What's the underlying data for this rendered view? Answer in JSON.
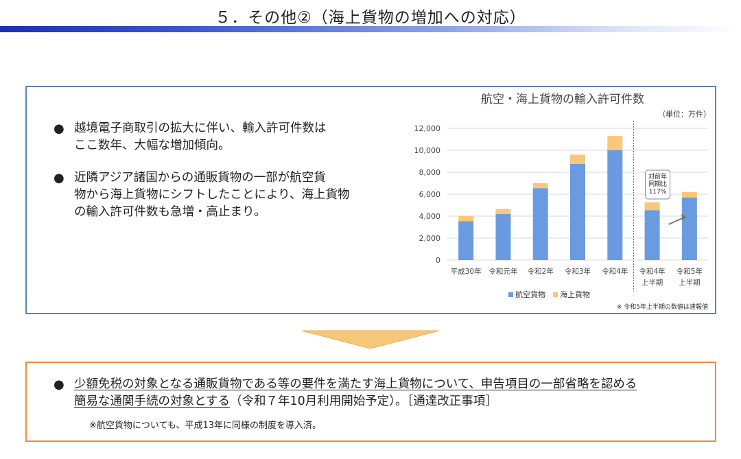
{
  "header": {
    "title": "５．その他②（海上貨物の増加への対応）"
  },
  "bullets": [
    {
      "dot": "●",
      "lines": [
        "越境電子商取引の拡大に伴い、輸入許可件数は",
        "ここ数年、大幅な増加傾向。"
      ]
    },
    {
      "dot": "●",
      "lines": [
        "近隣アジア諸国からの通販貨物の一部が航空貨",
        "物から海上貨物にシフトしたことにより、海上貨物",
        "の輸入許可件数も急増・高止まり。"
      ]
    }
  ],
  "chart_data": {
    "type": "bar",
    "stacked": true,
    "title": "航空・海上貨物の輸入許可件数",
    "unit": "（単位：万件）",
    "categories": [
      [
        "平成30年"
      ],
      [
        "令和元年"
      ],
      [
        "令和2年"
      ],
      [
        "令和3年"
      ],
      [
        "令和4年"
      ],
      [
        "令和4年",
        "上半期"
      ],
      [
        "令和5年",
        "上半期"
      ]
    ],
    "series": [
      {
        "name": "航空貨物",
        "color": "#6a9be0",
        "values": [
          3550,
          4200,
          6550,
          8750,
          10000,
          4550,
          5700
        ]
      },
      {
        "name": "海上貨物",
        "color": "#f8c87a",
        "values": [
          450,
          450,
          450,
          850,
          1300,
          700,
          500
        ]
      }
    ],
    "ylim": [
      0,
      12000
    ],
    "yticks": [
      "0",
      "2,000",
      "4,000",
      "6,000",
      "8,000",
      "10,000",
      "12,000"
    ],
    "grid": true,
    "legend": "bottom",
    "annotation": {
      "lines": [
        "対前年",
        "同期比",
        "117%"
      ]
    },
    "footnote": "※ 令和5年上半期の数値は速報値"
  },
  "bottom": {
    "dot": "●",
    "line1_underlined": "少額免税の対象となる通販貨物である等の要件を満たす海上貨物について、申告項目の一部省略を認める",
    "line2_underlined": "簡易な通関手続の対象とする",
    "line2_rest": "（令和７年10月利用開始予定）。［通達改正事項］",
    "note": "※航空貨物についても、平成13年に同様の制度を導入済。"
  },
  "colors": {
    "title_bar": "#1d2fb8",
    "top_border": "#5a84b4",
    "bottom_border": "#ed8c3a",
    "arrow": "#f8c87a"
  }
}
